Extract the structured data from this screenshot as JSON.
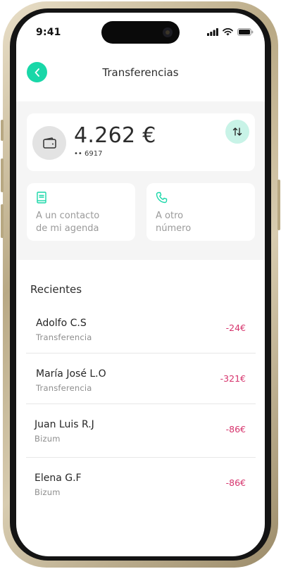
{
  "status_bar": {
    "time": "9:41"
  },
  "header": {
    "title": "Transferencias"
  },
  "balance": {
    "amount": "4.262 €",
    "card_number": "•• 6917"
  },
  "options": [
    {
      "label_line1": "A un  contacto",
      "label_line2": "de mi agenda",
      "icon": "contacts-book-icon"
    },
    {
      "label_line1": "A otro",
      "label_line2": "número",
      "icon": "phone-icon"
    }
  ],
  "recents": {
    "title": "Recientes",
    "items": [
      {
        "name": "Adolfo C.S",
        "type": "Transferencia",
        "amount": "-24€"
      },
      {
        "name": "María José L.O",
        "type": "Transferencia",
        "amount": "-321€"
      },
      {
        "name": "Juan Luis R.J",
        "type": "Bizum",
        "amount": "-86€"
      },
      {
        "name": "Elena G.F",
        "type": "Bizum",
        "amount": "-86€"
      }
    ]
  },
  "colors": {
    "accent": "#19d7a8",
    "accent_light": "#c8f3e7",
    "negative_amount": "#d6336c"
  }
}
